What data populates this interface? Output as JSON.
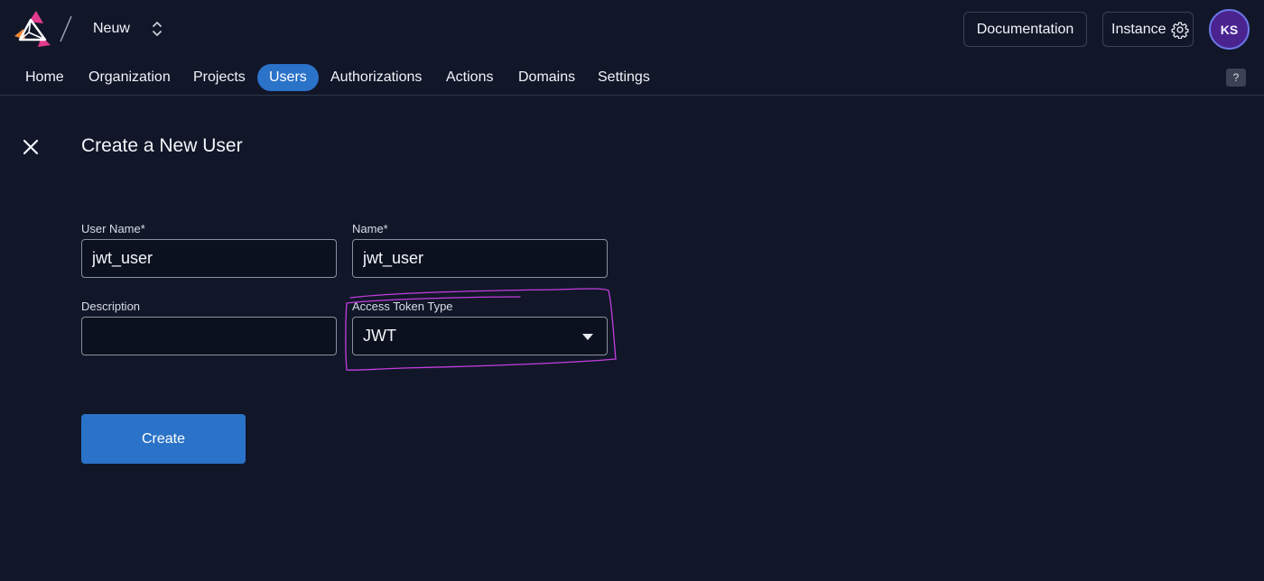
{
  "header": {
    "logo": "zitadel-logo-icon",
    "org_name": "Neuw",
    "documentation_label": "Documentation",
    "instance_label": "Instance",
    "avatar_initials": "KS"
  },
  "nav": {
    "items": [
      {
        "label": "Home",
        "active": false
      },
      {
        "label": "Organization",
        "active": false
      },
      {
        "label": "Projects",
        "active": false
      },
      {
        "label": "Users",
        "active": true
      },
      {
        "label": "Authorizations",
        "active": false
      },
      {
        "label": "Actions",
        "active": false
      },
      {
        "label": "Domains",
        "active": false
      },
      {
        "label": "Settings",
        "active": false
      }
    ],
    "help_label": "?"
  },
  "page": {
    "title": "Create a New User"
  },
  "form": {
    "user_name": {
      "label": "User Name*",
      "value": "jwt_user"
    },
    "name": {
      "label": "Name*",
      "value": "jwt_user"
    },
    "description": {
      "label": "Description",
      "value": ""
    },
    "access_token_type": {
      "label": "Access Token Type",
      "value": "JWT"
    },
    "create_label": "Create"
  },
  "colors": {
    "background": "#111729",
    "accent": "#2b72c9",
    "highlight_annotation": "#c43de0"
  }
}
